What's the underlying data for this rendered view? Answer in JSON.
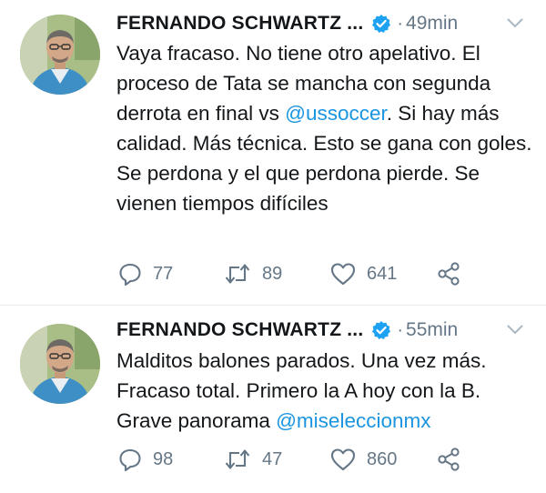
{
  "tweets": [
    {
      "name": "FERNANDO SCHWARTZ ...",
      "separator": "·",
      "time": "49min",
      "text_before": "Vaya fracaso. No tiene otro apelativo. El proceso de Tata se mancha con segunda derrota en final vs ",
      "mention": "@ussoccer",
      "text_after": ". Si hay más calidad. Más técnica. Esto se gana con goles. Se perdona y el que perdona pierde. Se vienen tiempos difíciles",
      "replies": "77",
      "retweets": "89",
      "likes": "641"
    },
    {
      "name": "FERNANDO SCHWARTZ ...",
      "separator": "·",
      "time": "55min",
      "text_before": "Malditos balones parados. Una vez más. Fracaso total. Primero la A hoy con la B. Grave panorama ",
      "mention": "@miseleccionmx",
      "text_after": "",
      "replies": "98",
      "retweets": "47",
      "likes": "860"
    }
  ],
  "icons": {
    "reply": "reply-icon",
    "retweet": "retweet-icon",
    "like": "heart-icon",
    "share": "share-icon",
    "verified": "verified-badge-icon",
    "caret": "chevron-down-icon"
  },
  "colors": {
    "mention": "#1b95e0",
    "verified": "#1da1f2",
    "secondary_text": "#657786",
    "divider": "#e6ecf0"
  }
}
